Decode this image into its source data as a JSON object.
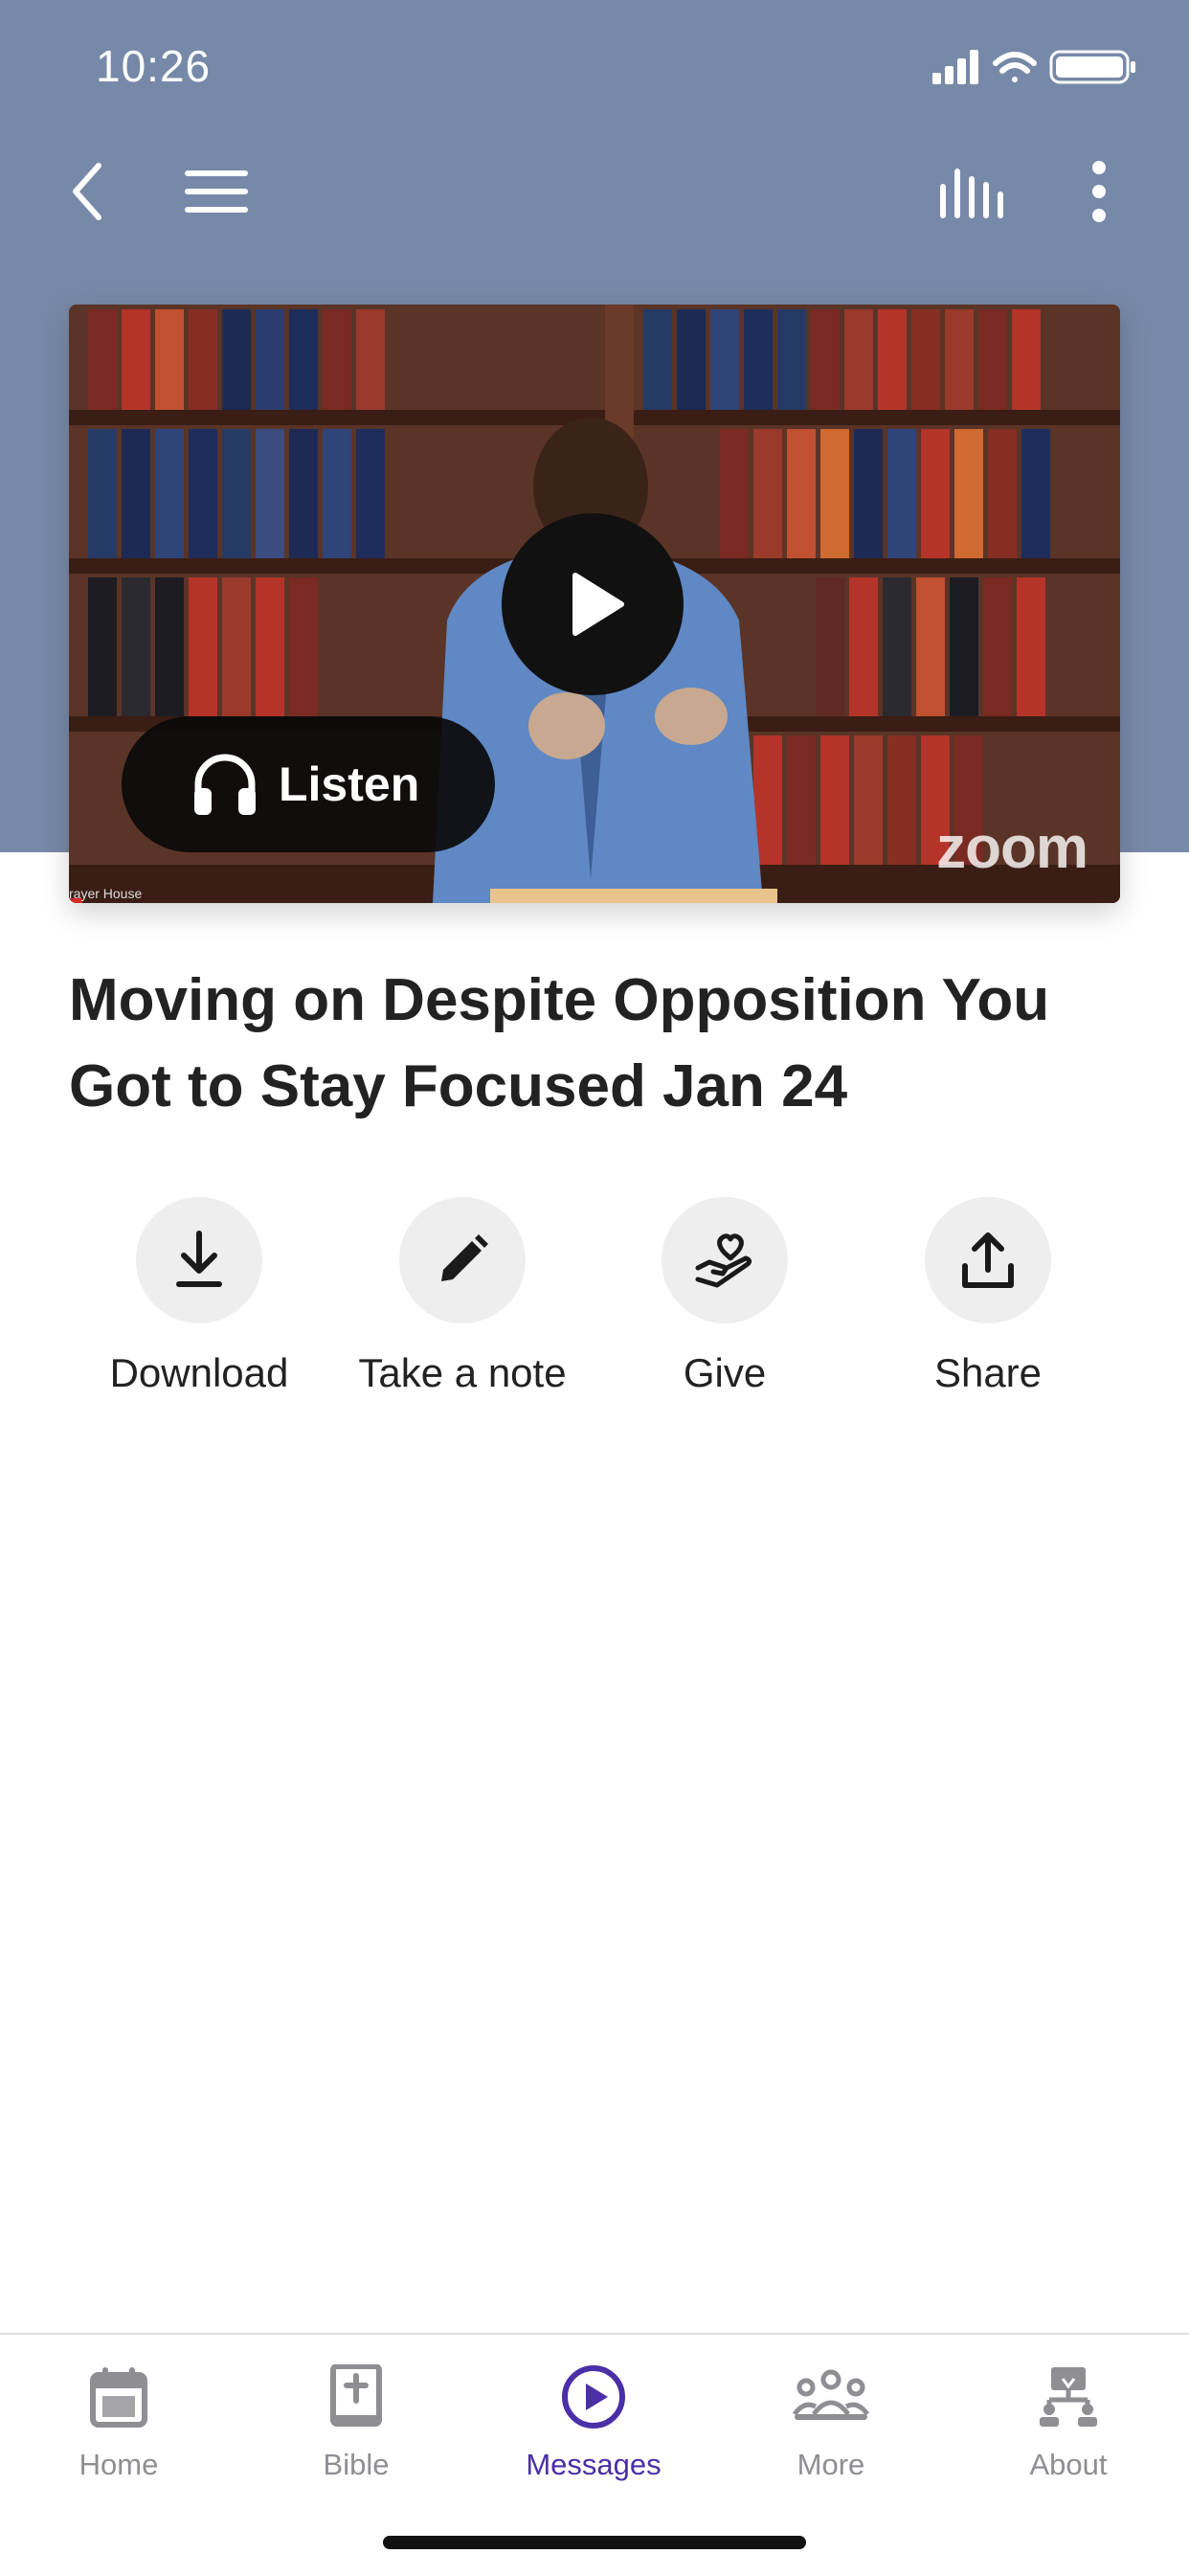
{
  "status_bar": {
    "time": "10:26"
  },
  "video": {
    "listen_label": "Listen",
    "watermark": "zoom",
    "source_label": "rayer House"
  },
  "title": "Moving on Despite Opposition You Got to Stay Focused Jan 24",
  "actions": [
    {
      "label": "Download",
      "icon": "download-icon"
    },
    {
      "label": "Take a note",
      "icon": "pencil-icon"
    },
    {
      "label": "Give",
      "icon": "give-heart-hand-icon"
    },
    {
      "label": "Share",
      "icon": "share-icon"
    }
  ],
  "tabs": [
    {
      "label": "Home",
      "icon": "calendar-icon",
      "active": false
    },
    {
      "label": "Bible",
      "icon": "bible-icon",
      "active": false
    },
    {
      "label": "Messages",
      "icon": "play-circle-icon",
      "active": true
    },
    {
      "label": "More",
      "icon": "people-icon",
      "active": false
    },
    {
      "label": "About",
      "icon": "org-chart-icon",
      "active": false
    }
  ],
  "colors": {
    "header": "#7789a8",
    "active_tab": "#4b2fa8",
    "inactive_tab": "#8e8e93"
  }
}
